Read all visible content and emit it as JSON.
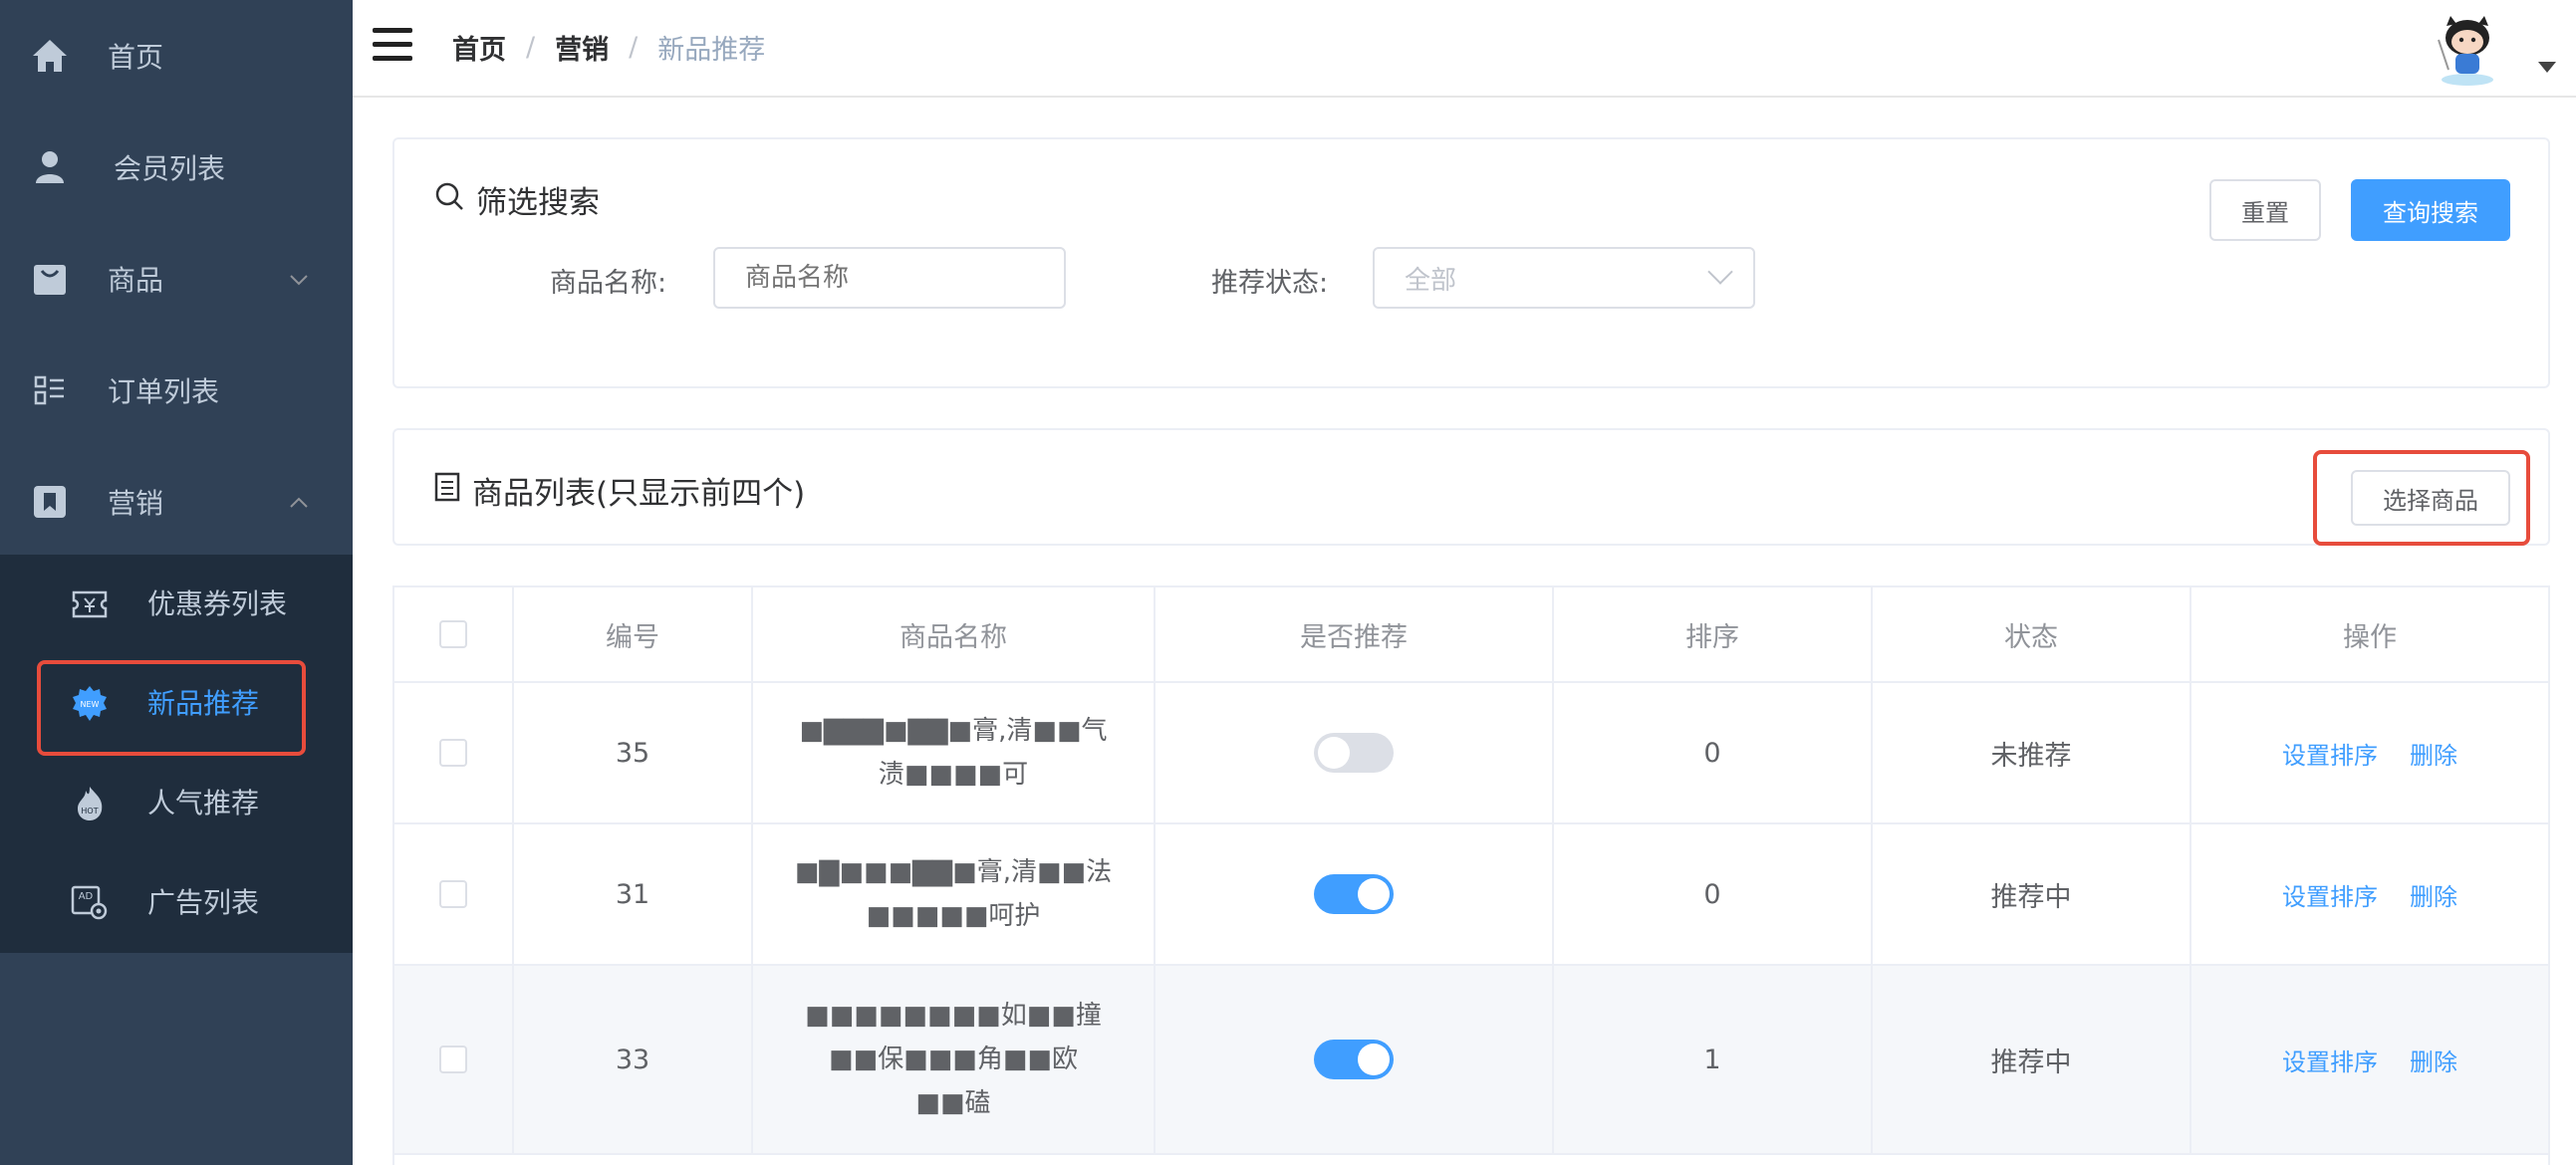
{
  "sidebar": {
    "items": [
      {
        "label": "首页",
        "icon": "home-icon"
      },
      {
        "label": "会员列表",
        "icon": "user-icon"
      },
      {
        "label": "商品",
        "icon": "shopping-bag-icon"
      },
      {
        "label": "订单列表",
        "icon": "order-list-icon"
      },
      {
        "label": "营销",
        "icon": "bookmark-icon"
      }
    ],
    "submenu": [
      {
        "label": "优惠券列表",
        "icon": "coupon-icon"
      },
      {
        "label": "新品推荐",
        "icon": "new-badge-icon"
      },
      {
        "label": "人气推荐",
        "icon": "hot-icon"
      },
      {
        "label": "广告列表",
        "icon": "ad-icon"
      }
    ]
  },
  "header": {
    "breadcrumb": [
      "首页",
      "营销",
      "新品推荐"
    ]
  },
  "filter": {
    "title": "筛选搜索",
    "reset_label": "重置",
    "search_label": "查询搜索",
    "name_label": "商品名称:",
    "name_placeholder": "商品名称",
    "status_label": "推荐状态:",
    "status_value": "全部"
  },
  "list": {
    "title": "商品列表(只显示前四个)",
    "select_button": "选择商品"
  },
  "table": {
    "headers": [
      "编号",
      "商品名称",
      "是否推荐",
      "排序",
      "状态",
      "操作"
    ],
    "rows": [
      {
        "id": "35",
        "name_line1": "■▇▇▇■▇▇■膏,清■■气",
        "name_line2": "渍■■■■可",
        "recommended": false,
        "sort": "0",
        "status": "未推荐"
      },
      {
        "id": "31",
        "name_line1": "■▇■■■▇▇■膏,清■■法",
        "name_line2": "■■■■■呵护",
        "recommended": true,
        "sort": "0",
        "status": "推荐中"
      },
      {
        "id": "33",
        "name_line1": "■■■■■■■■如■■撞",
        "name_line2": "■■保■■■角■■欧",
        "name_line3": "■■磕",
        "recommended": true,
        "sort": "1",
        "status": "推荐中"
      }
    ],
    "action_set_sort": "设置排序",
    "action_delete": "删除"
  },
  "colors": {
    "sidebar_bg": "#304156",
    "submenu_bg": "#1f2d3d",
    "primary": "#409eff",
    "highlight_box": "#e74c3c"
  }
}
